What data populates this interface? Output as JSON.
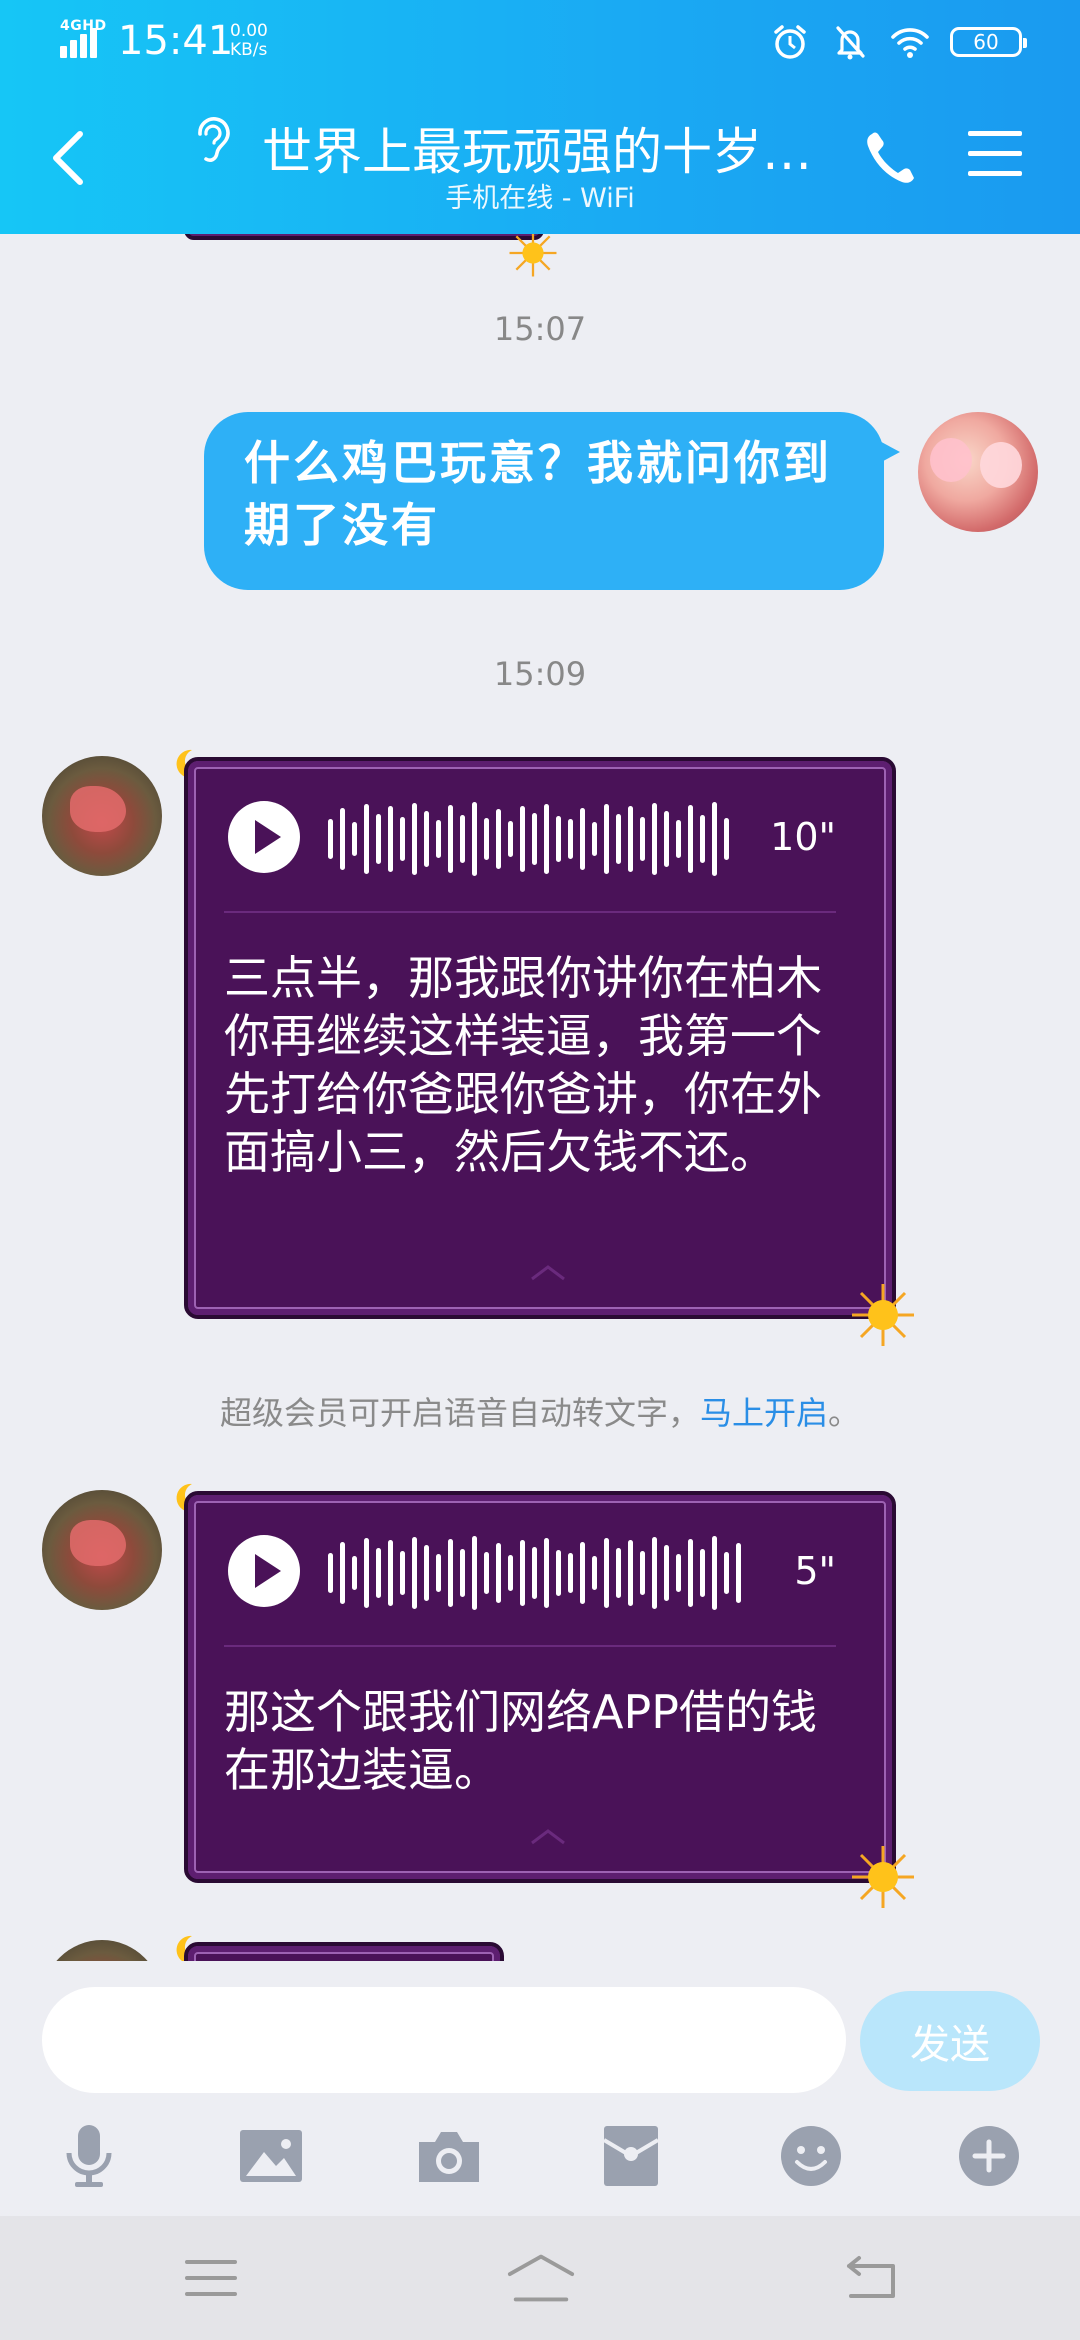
{
  "status_bar": {
    "network": "4GHD",
    "time": "15:41",
    "speed_value": "0.00",
    "speed_unit": "KB/s",
    "icons": [
      "alarm-icon",
      "mute-bell-icon",
      "wifi-icon"
    ],
    "battery": "60"
  },
  "header": {
    "title": "世界上最玩顽强的十岁…",
    "subtitle": "手机在线 - WiFi",
    "icons": [
      "back-icon",
      "ear-icon",
      "phone-icon",
      "menu-icon"
    ]
  },
  "messages": [
    {
      "timestamp": "15:07"
    },
    {
      "sender": "self",
      "text_line1": "什么鸡巴玩意？我就问你到",
      "text_line2": "期了没有"
    },
    {
      "timestamp": "15:09"
    },
    {
      "sender": "other",
      "type": "voice",
      "duration": "10\"",
      "transcript": "三点半，那我跟你讲你在柏木你再继续这样装逼，我第一个先打给你爸跟你爸讲，你在外面搞小三，然后欠钱不还。"
    },
    {
      "notice": "超级会员可开启语音自动转文字，",
      "notice_link": "马上开启",
      "notice_end": "。"
    },
    {
      "sender": "other",
      "type": "voice",
      "duration": "5\"",
      "transcript": "那这个跟我们网络APP借的钱在那边装逼。"
    }
  ],
  "input": {
    "value": "",
    "placeholder": "",
    "send_label": "发送"
  },
  "toolbar": [
    "microphone-icon",
    "image-icon",
    "camera-icon",
    "red-packet-icon",
    "emoji-icon",
    "plus-icon"
  ],
  "nav": [
    "recent-apps-icon",
    "home-icon",
    "back-nav-icon"
  ],
  "colors": {
    "header_start": "#16c6f6",
    "header_end": "#1a9af0",
    "self_bubble": "#2eb0f6",
    "voice_card": "#4a1258",
    "link": "#2a8ee6",
    "send_disabled": "#b9e6fb"
  }
}
